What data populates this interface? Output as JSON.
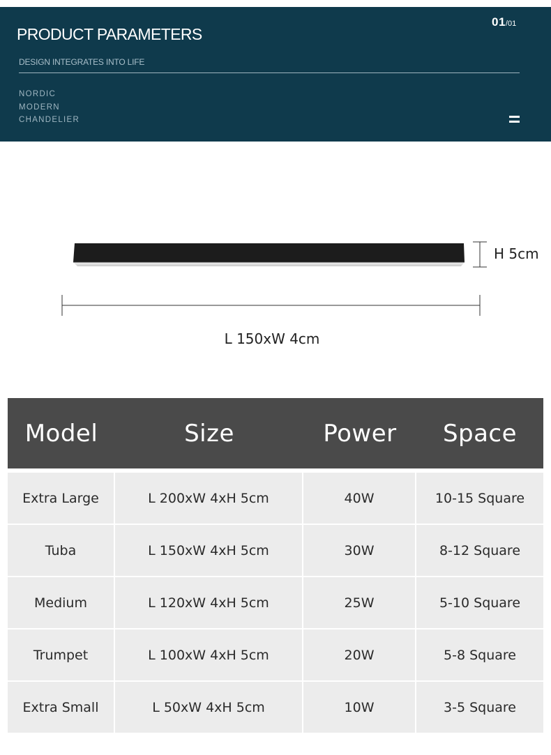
{
  "banner": {
    "title": "PRODUCT PARAMETERS",
    "subtitle": "DESIGN INTEGRATES INTO LIFE",
    "tags": [
      "NORDIC",
      "MODERN",
      "CHANDELIER"
    ],
    "page_current": "01",
    "page_separator": "/",
    "page_total": "01",
    "background_color": "#0f3a4c"
  },
  "drawing": {
    "height_label": "H 5cm",
    "length_label": "L 150xW 4cm"
  },
  "table": {
    "header_color": "#4a4a4a",
    "row_color": "#ececec",
    "columns": [
      "Model",
      "Size",
      "Power",
      "Space"
    ],
    "rows": [
      [
        "Extra Large",
        "L 200xW 4xH 5cm",
        "40W",
        "10-15 Square"
      ],
      [
        "Tuba",
        "L 150xW 4xH 5cm",
        "30W",
        "8-12 Square"
      ],
      [
        "Medium",
        "L 120xW 4xH 5cm",
        "25W",
        "5-10 Square"
      ],
      [
        "Trumpet",
        "L 100xW 4xH 5cm",
        "20W",
        "5-8 Square"
      ],
      [
        "Extra Small",
        "L 50xW 4xH 5cm",
        "10W",
        "3-5 Square"
      ]
    ]
  }
}
